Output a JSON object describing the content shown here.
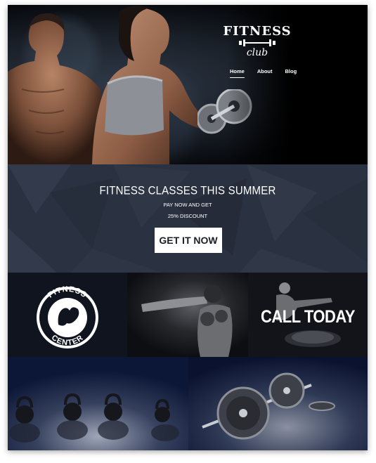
{
  "site": {
    "logo": {
      "line1": "FITNESS",
      "line2": "club"
    },
    "nav": [
      {
        "label": "Home",
        "active": true
      },
      {
        "label": "About",
        "active": false
      },
      {
        "label": "Blog",
        "active": false
      }
    ]
  },
  "promo": {
    "title": "FITNESS CLASSES THIS SUMMER",
    "line1": "PAY NOW AND GET",
    "line2": "25% DISCOUNT",
    "cta": "GET IT NOW"
  },
  "tiles": {
    "badge": {
      "top": "FITNESS",
      "bottom": "CENTER"
    },
    "call": "CALL TODAY"
  },
  "colors": {
    "promo_bg": "#2a3140",
    "row1_bg": "#0f141f",
    "row2_bg": "#0c1636",
    "cta_bg": "#ffffff"
  }
}
